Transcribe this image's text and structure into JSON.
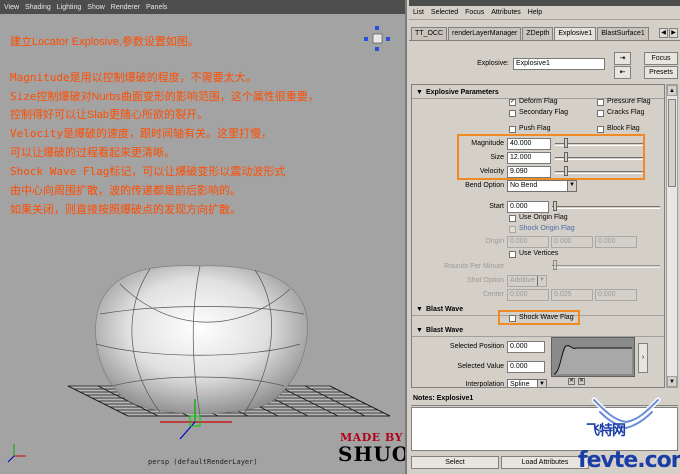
{
  "viewport": {
    "menu": [
      "View",
      "Shading",
      "Lighting",
      "Show",
      "Renderer",
      "Panels"
    ],
    "annotations": [
      {
        "en": "",
        "cn": "建立Locator Explosive,参数设置如图。"
      },
      {
        "en": "Magnitude",
        "cn": "是用以控制爆破的程度，不需要太大。"
      },
      {
        "en": "Size",
        "cn": "控制爆破对Nurbs曲面变形的影响范围，这个属性很重要，"
      },
      {
        "en": "",
        "cn": "控制得好可以让Slab更随心所欲的裂开。"
      },
      {
        "en": "Velocity",
        "cn": "是爆破的速度，跟时间轴有关。这里打慢，"
      },
      {
        "en": "",
        "cn": "可以让爆破的过程看起来更清晰。"
      },
      {
        "en": "Shock Wave Flag",
        "cn": "标记，可以让爆破变形以震动波形式"
      },
      {
        "en": "",
        "cn": "由中心向周围扩散，波的传递都是前后影响的。"
      },
      {
        "en": "",
        "cn": "如果关闭，则直接按照爆破点的发现方向扩散。"
      }
    ],
    "camera_label": "persp (defaultRenderLayer)",
    "made_by": "MADE BY",
    "author": "SHUO"
  },
  "attribute_editor": {
    "menu": [
      "List",
      "Selected",
      "Focus",
      "Attributes",
      "Help"
    ],
    "tabs": [
      "TT_OCC",
      "renderLayerManager",
      "ZDepth",
      "Explosive1",
      "BlastSurface1"
    ],
    "active_tab": "Explosive1",
    "node_label": "Explosive:",
    "node_name": "Explosive1",
    "focus_label": "Focus",
    "presets_label": "Presets",
    "sections": {
      "explosive_params": "Explosive Parameters",
      "blast_wave_collapsed": "Blast Wave",
      "blast_wave": "Blast Wave"
    },
    "flags": {
      "deform": {
        "label": "Deform Flag",
        "checked": true
      },
      "pressure": {
        "label": "Pressure Flag",
        "checked": false
      },
      "secondary": {
        "label": "Secondary Flag",
        "checked": false
      },
      "cracks": {
        "label": "Cracks Flag",
        "checked": false
      },
      "push": {
        "label": "Push Flag",
        "checked": false
      },
      "block": {
        "label": "Block Flag",
        "checked": false
      }
    },
    "magnitude": {
      "label": "Magnitude",
      "value": "40.000",
      "level": 0.1
    },
    "size": {
      "label": "Size",
      "value": "12.000",
      "level": 0.1
    },
    "velocity": {
      "label": "Velocity",
      "value": "9.090",
      "level": 0.1
    },
    "bend_option": {
      "label": "Bend Option",
      "value": "No Bend"
    },
    "start": {
      "label": "Start",
      "value": "0.000"
    },
    "use_origin_flag": "Use Origin Flag",
    "shock_origin_flag": "Shock Origin Flag",
    "origin": {
      "label": "Origin",
      "values": [
        "0.000",
        "0.000",
        "0.000"
      ]
    },
    "use_vertices": "Use Vertices",
    "rounds_per_minute": "Rounds Per Minute",
    "shot_option": {
      "label": "Shot Option",
      "value": "Additive"
    },
    "center": {
      "label": "Center",
      "values": [
        "0.000",
        "0.025",
        "0.000"
      ]
    },
    "shock_wave_flag": {
      "label": "Shock Wave Flag",
      "checked": false
    },
    "selected_position": {
      "label": "Selected Position",
      "value": "0.000"
    },
    "selected_value": {
      "label": "Selected Value",
      "value": "0.000"
    },
    "interpolation": {
      "label": "Interpolation",
      "value": "Spline"
    },
    "notes_label": "Notes: Explosive1",
    "select_label": "Select",
    "load_attributes_label": "Load Attributes"
  },
  "watermark": {
    "cn": "飞特网",
    "en": "fevte.com"
  },
  "colors": {
    "annotation": "#ff4d00",
    "highlight": "#f08a24",
    "made_by": "#b3001a",
    "watermark": "#1a3da8"
  }
}
